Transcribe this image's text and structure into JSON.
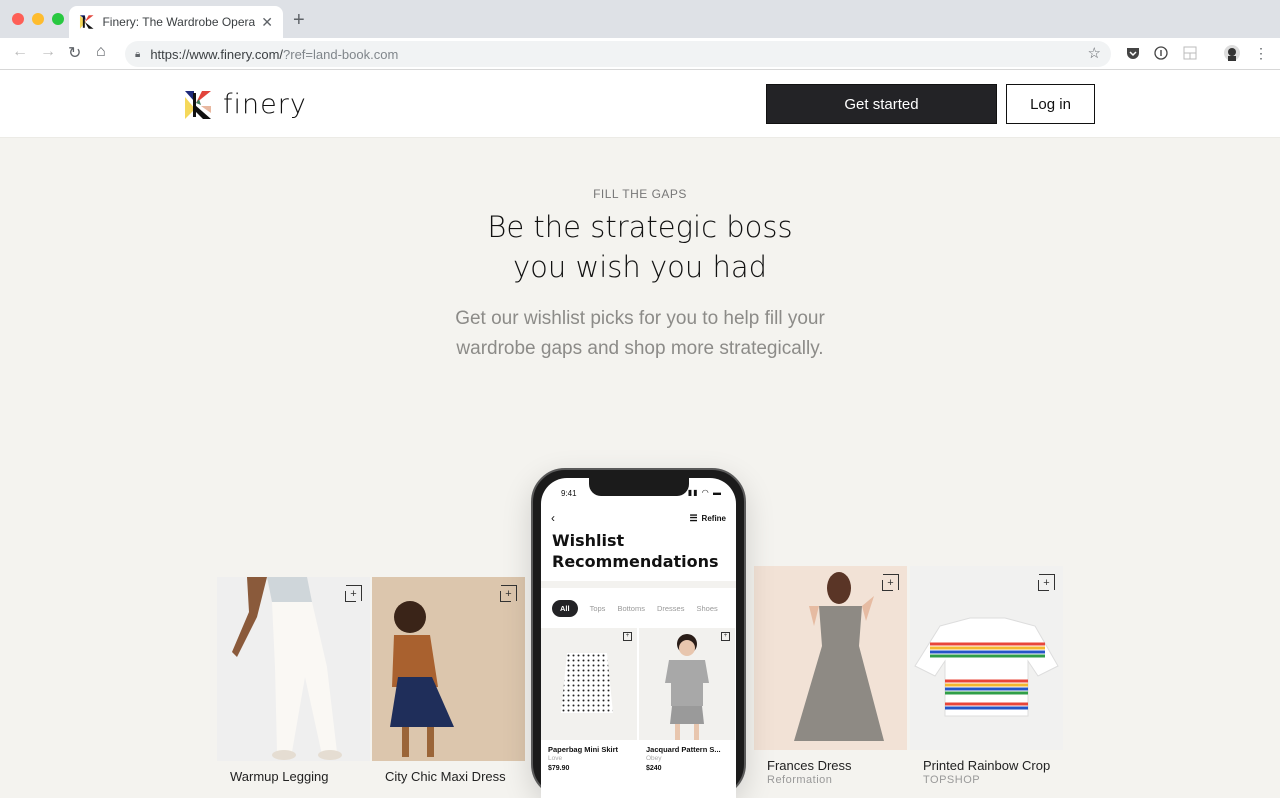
{
  "browser": {
    "tab_title": "Finery: The Wardrobe Operating System",
    "new_tab_icon": "plus-icon",
    "url_host": "https://www.finery.com/",
    "url_query": "?ref=land-book.com",
    "traffic_colors": {
      "close": "#fe5f57",
      "minimize": "#febc2e",
      "maximize": "#28c840"
    }
  },
  "header": {
    "logo_text": "finery",
    "get_started": "Get started",
    "log_in": "Log in"
  },
  "hero": {
    "eyebrow": "FILL THE GAPS",
    "headline_line1": "Be the strategic boss",
    "headline_line2": "you wish you had",
    "subtext": "Get our wishlist picks for you to help fill your wardrobe gaps and shop more strategically."
  },
  "products": [
    {
      "name": "Warmup Legging",
      "brand": ""
    },
    {
      "name": "City Chic Maxi Dress",
      "brand": ""
    },
    {
      "name": "Frances Dress",
      "brand": "Reformation"
    },
    {
      "name": "Printed Rainbow Crop",
      "brand": "TOPSHOP"
    }
  ],
  "phone": {
    "time": "9:41",
    "refine": "Refine",
    "title_line1": "Wishlist",
    "title_line2": "Recommendations",
    "chips": [
      "All",
      "Tops",
      "Bottoms",
      "Dresses",
      "Shoes"
    ],
    "items": [
      {
        "name": "Paperbag Mini Skirt",
        "brand": "Love",
        "price": "$79.90"
      },
      {
        "name": "Jacquard Pattern S...",
        "brand": "Obey",
        "price": "$240"
      }
    ]
  }
}
